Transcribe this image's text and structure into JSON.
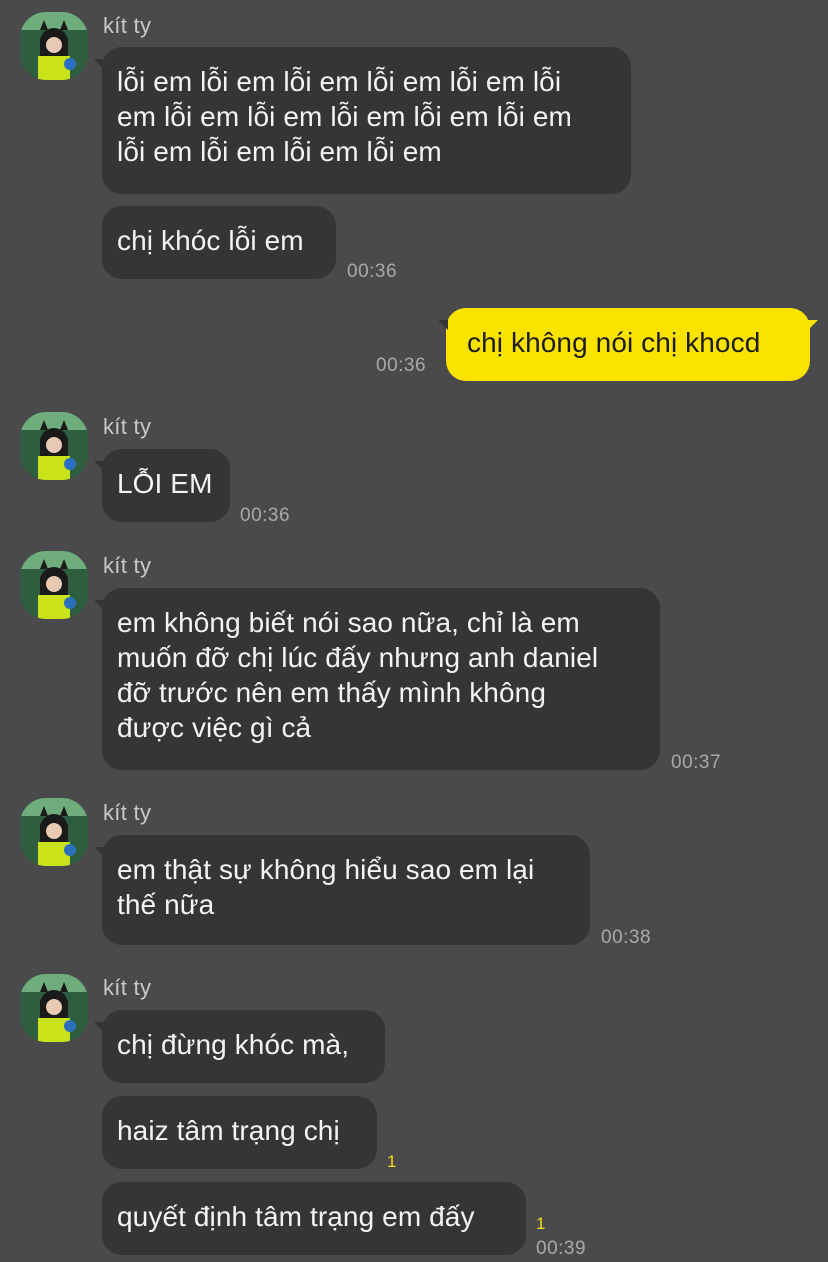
{
  "chat": {
    "sender_name": "kít ty",
    "groups": [
      {
        "messages": [
          "lỗi em lỗi em lỗi em lỗi em lỗi em lỗi\nem lỗi em lỗi em lỗi em lỗi em lỗi em\nlỗi em lỗi em lỗi em lỗi em",
          "chị khóc lỗi em"
        ],
        "time": "00:36"
      },
      {
        "from_me": true,
        "messages": [
          "chị không nói chị khocd"
        ],
        "time": "00:36"
      },
      {
        "messages": [
          "LỖI EM"
        ],
        "time": "00:36"
      },
      {
        "messages": [
          "em không biết nói sao nữa, chỉ là em\nmuốn đỡ chị lúc đấy nhưng anh daniel\nđỡ trước nên em thấy mình không\nđược việc gì cả"
        ],
        "time": "00:37"
      },
      {
        "messages": [
          "em thật sự không hiểu sao em lại\nthế nữa"
        ],
        "time": "00:38"
      },
      {
        "messages": [
          "chị đừng khóc mà,",
          "haiz tâm trạng chị",
          "quyết định tâm trạng em đấy"
        ],
        "unread": [
          "1",
          "1"
        ],
        "time": "00:39"
      }
    ]
  },
  "colors": {
    "background": "#4a494c",
    "incoming_bubble": "#353437",
    "outgoing_bubble": "#fbe300",
    "unread_count": "#f4dd13"
  }
}
